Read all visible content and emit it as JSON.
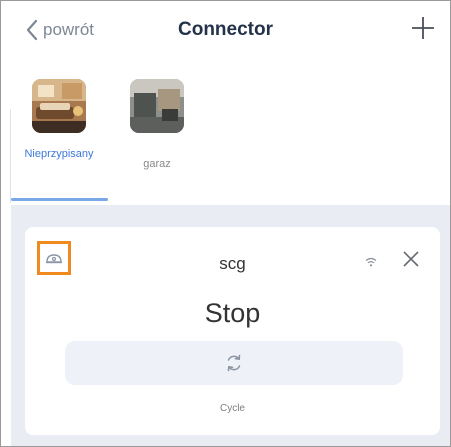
{
  "header": {
    "back_label": "powrót",
    "title": "Connector"
  },
  "rooms": [
    {
      "name": "Nieprzypisany",
      "active": true
    },
    {
      "name": "garaz",
      "active": false
    }
  ],
  "device": {
    "name": "scg",
    "state": "Stop",
    "action_label": "Cycle"
  },
  "colors": {
    "accent": "#3d78d8",
    "highlight": "#f08a1e",
    "background": "#e9edf3"
  }
}
